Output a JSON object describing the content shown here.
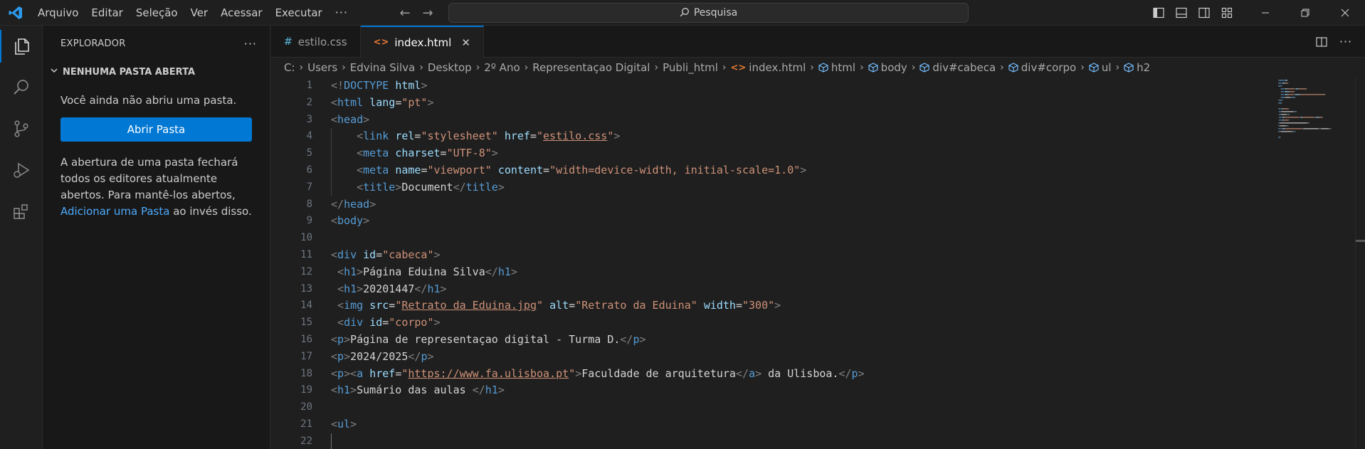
{
  "menu": [
    "Arquivo",
    "Editar",
    "Seleção",
    "Ver",
    "Acessar",
    "Executar"
  ],
  "menu_more": "···",
  "search": {
    "label": "Pesquisa"
  },
  "sidebar": {
    "title": "EXPLORADOR",
    "section": "NENHUMA PASTA ABERTA",
    "no_folder_text": "Você ainda não abriu uma pasta.",
    "open_folder_button": "Abrir Pasta",
    "info_text": "A abertura de uma pasta fechará todos os editores atualmente abertos. Para mantê-los abertos,",
    "add_folder_link": "Adicionar uma Pasta",
    "info_suffix": " ao invés disso."
  },
  "tabs": [
    {
      "label": "estilo.css",
      "active": false
    },
    {
      "label": "index.html",
      "active": true
    }
  ],
  "breadcrumb": [
    "C:",
    "Users",
    "Edvina Silva",
    "Desktop",
    "2º Ano",
    "Representaçao Digital",
    "Publi_html",
    "index.html",
    "html",
    "body",
    "div#cabeca",
    "div#corpo",
    "ul",
    "h2"
  ],
  "code_lines": [
    [
      [
        "p",
        "<!"
      ],
      [
        "tag",
        "DOCTYPE"
      ],
      [
        "txt",
        " "
      ],
      [
        "attr",
        "html"
      ],
      [
        "p",
        ">"
      ]
    ],
    [
      [
        "p",
        "<"
      ],
      [
        "tag",
        "html"
      ],
      [
        "txt",
        " "
      ],
      [
        "attr",
        "lang"
      ],
      [
        "txt",
        "="
      ],
      [
        "str",
        "\"pt\""
      ],
      [
        "p",
        ">"
      ]
    ],
    [
      [
        "p",
        "<"
      ],
      [
        "tag",
        "head"
      ],
      [
        "p",
        ">"
      ]
    ],
    [
      [
        "txt",
        "    "
      ],
      [
        "p",
        "<"
      ],
      [
        "tag",
        "link"
      ],
      [
        "txt",
        " "
      ],
      [
        "attr",
        "rel"
      ],
      [
        "txt",
        "="
      ],
      [
        "str",
        "\"stylesheet\""
      ],
      [
        "txt",
        " "
      ],
      [
        "attr",
        "href"
      ],
      [
        "txt",
        "="
      ],
      [
        "str",
        "\""
      ],
      [
        "url",
        "estilo.css"
      ],
      [
        "str",
        "\""
      ],
      [
        "p",
        ">"
      ]
    ],
    [
      [
        "txt",
        "    "
      ],
      [
        "p",
        "<"
      ],
      [
        "tag",
        "meta"
      ],
      [
        "txt",
        " "
      ],
      [
        "attr",
        "charset"
      ],
      [
        "txt",
        "="
      ],
      [
        "str",
        "\"UTF-8\""
      ],
      [
        "p",
        ">"
      ]
    ],
    [
      [
        "txt",
        "    "
      ],
      [
        "p",
        "<"
      ],
      [
        "tag",
        "meta"
      ],
      [
        "txt",
        " "
      ],
      [
        "attr",
        "name"
      ],
      [
        "txt",
        "="
      ],
      [
        "str",
        "\"viewport\""
      ],
      [
        "txt",
        " "
      ],
      [
        "attr",
        "content"
      ],
      [
        "txt",
        "="
      ],
      [
        "str",
        "\"width=device-width, initial-scale=1.0\""
      ],
      [
        "p",
        ">"
      ]
    ],
    [
      [
        "txt",
        "    "
      ],
      [
        "p",
        "<"
      ],
      [
        "tag",
        "title"
      ],
      [
        "p",
        ">"
      ],
      [
        "txt",
        "Document"
      ],
      [
        "p",
        "</"
      ],
      [
        "tag",
        "title"
      ],
      [
        "p",
        ">"
      ]
    ],
    [
      [
        "p",
        "</"
      ],
      [
        "tag",
        "head"
      ],
      [
        "p",
        ">"
      ]
    ],
    [
      [
        "p",
        "<"
      ],
      [
        "tag",
        "body"
      ],
      [
        "p",
        ">"
      ]
    ],
    [],
    [
      [
        "p",
        "<"
      ],
      [
        "tag",
        "div"
      ],
      [
        "txt",
        " "
      ],
      [
        "attr",
        "id"
      ],
      [
        "txt",
        "="
      ],
      [
        "str",
        "\"cabeca\""
      ],
      [
        "p",
        ">"
      ]
    ],
    [
      [
        "txt",
        " "
      ],
      [
        "p",
        "<"
      ],
      [
        "tag",
        "h1"
      ],
      [
        "p",
        ">"
      ],
      [
        "txt",
        "Página Eduina Silva"
      ],
      [
        "p",
        "</"
      ],
      [
        "tag",
        "h1"
      ],
      [
        "p",
        ">"
      ]
    ],
    [
      [
        "txt",
        " "
      ],
      [
        "p",
        "<"
      ],
      [
        "tag",
        "h1"
      ],
      [
        "p",
        ">"
      ],
      [
        "txt",
        "20201447"
      ],
      [
        "p",
        "</"
      ],
      [
        "tag",
        "h1"
      ],
      [
        "p",
        ">"
      ]
    ],
    [
      [
        "txt",
        " "
      ],
      [
        "p",
        "<"
      ],
      [
        "tag",
        "img"
      ],
      [
        "txt",
        " "
      ],
      [
        "attr",
        "src"
      ],
      [
        "txt",
        "="
      ],
      [
        "str",
        "\""
      ],
      [
        "url",
        "Retrato da Eduina.jpg"
      ],
      [
        "str",
        "\""
      ],
      [
        "txt",
        " "
      ],
      [
        "attr",
        "alt"
      ],
      [
        "txt",
        "="
      ],
      [
        "str",
        "\"Retrato da Eduina\""
      ],
      [
        "txt",
        " "
      ],
      [
        "attr",
        "width"
      ],
      [
        "txt",
        "="
      ],
      [
        "str",
        "\"300\""
      ],
      [
        "p",
        ">"
      ]
    ],
    [
      [
        "txt",
        " "
      ],
      [
        "p",
        "<"
      ],
      [
        "tag",
        "div"
      ],
      [
        "txt",
        " "
      ],
      [
        "attr",
        "id"
      ],
      [
        "txt",
        "="
      ],
      [
        "str",
        "\"corpo\""
      ],
      [
        "p",
        ">"
      ]
    ],
    [
      [
        "p",
        "<"
      ],
      [
        "tag",
        "p"
      ],
      [
        "p",
        ">"
      ],
      [
        "txt",
        "Página de representaçao digital - Turma D."
      ],
      [
        "p",
        "</"
      ],
      [
        "tag",
        "p"
      ],
      [
        "p",
        ">"
      ]
    ],
    [
      [
        "p",
        "<"
      ],
      [
        "tag",
        "p"
      ],
      [
        "p",
        ">"
      ],
      [
        "txt",
        "2024/2025"
      ],
      [
        "p",
        "</"
      ],
      [
        "tag",
        "p"
      ],
      [
        "p",
        ">"
      ]
    ],
    [
      [
        "p",
        "<"
      ],
      [
        "tag",
        "p"
      ],
      [
        "p",
        "><"
      ],
      [
        "tag",
        "a"
      ],
      [
        "txt",
        " "
      ],
      [
        "attr",
        "href"
      ],
      [
        "txt",
        "="
      ],
      [
        "str",
        "\""
      ],
      [
        "url",
        "https://www.fa.ulisboa.pt"
      ],
      [
        "str",
        "\""
      ],
      [
        "p",
        ">"
      ],
      [
        "txt",
        "Faculdade de arquitetura"
      ],
      [
        "p",
        "</"
      ],
      [
        "tag",
        "a"
      ],
      [
        "p",
        ">"
      ],
      [
        "txt",
        " da Ulisboa."
      ],
      [
        "p",
        "</"
      ],
      [
        "tag",
        "p"
      ],
      [
        "p",
        ">"
      ]
    ],
    [
      [
        "p",
        "<"
      ],
      [
        "tag",
        "h1"
      ],
      [
        "p",
        ">"
      ],
      [
        "txt",
        "Sumário das aulas "
      ],
      [
        "p",
        "</"
      ],
      [
        "tag",
        "h1"
      ],
      [
        "p",
        ">"
      ]
    ],
    [],
    [
      [
        "p",
        "<"
      ],
      [
        "tag",
        "ul"
      ],
      [
        "p",
        ">"
      ]
    ],
    []
  ],
  "colors": {
    "accent": "#0078d4",
    "tag": "#569cd6",
    "attr": "#9cdcfe",
    "string": "#ce9178",
    "html_icon": "#e37933",
    "css_icon": "#519aba"
  },
  "icons": [
    "vscode-logo-icon",
    "arrow-left-icon",
    "arrow-right-icon",
    "search-icon",
    "explorer-icon",
    "search-view-icon",
    "source-control-icon",
    "run-debug-icon",
    "extensions-icon",
    "split-editor-icon",
    "more-actions-icon",
    "close-icon"
  ]
}
